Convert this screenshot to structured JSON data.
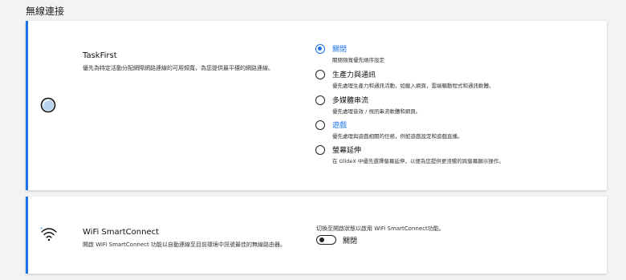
{
  "section_title": "無線連接",
  "colors": {
    "accent": "#1a73e8"
  },
  "taskfirst": {
    "icon": "taskfirst-gauge-icon",
    "title": "TaskFirst",
    "description": "優先為特定活動分配網際網路連線的可用頻寬，為您提供最平穩的網路連線。",
    "selected_index": 0,
    "options": [
      {
        "label": "關閉",
        "desc": "關閉頻寬優先順序設定"
      },
      {
        "label": "生產力與通訊",
        "desc": "優先處理生產力和通訊活動，如載入網頁，雲端驅動程式和通訊軟體。"
      },
      {
        "label": "多媒體串流",
        "desc": "優先處理音效 / 視訊串流軟體和網頁。"
      },
      {
        "label": "遊戲",
        "desc": "優先處理與遊戲相關的任務，例如遊戲設定和遊戲直播。"
      },
      {
        "label": "螢幕延伸",
        "desc": "在 GlideX 中優先選擇螢幕延伸，以便為您提供更流暢的跨螢幕顯示操作。"
      }
    ]
  },
  "wifi": {
    "icon": "wifi-icon",
    "title": "WiFi SmartConnect",
    "description": "開啟 WiFi SmartConnect 功能以自動連線至目前環境中訊號最佳的無線路由器。",
    "hint": "切換至開啟狀態以啟用 WiFi SmartConnect功能。",
    "toggle_state": "關閉",
    "toggle_on": false
  }
}
